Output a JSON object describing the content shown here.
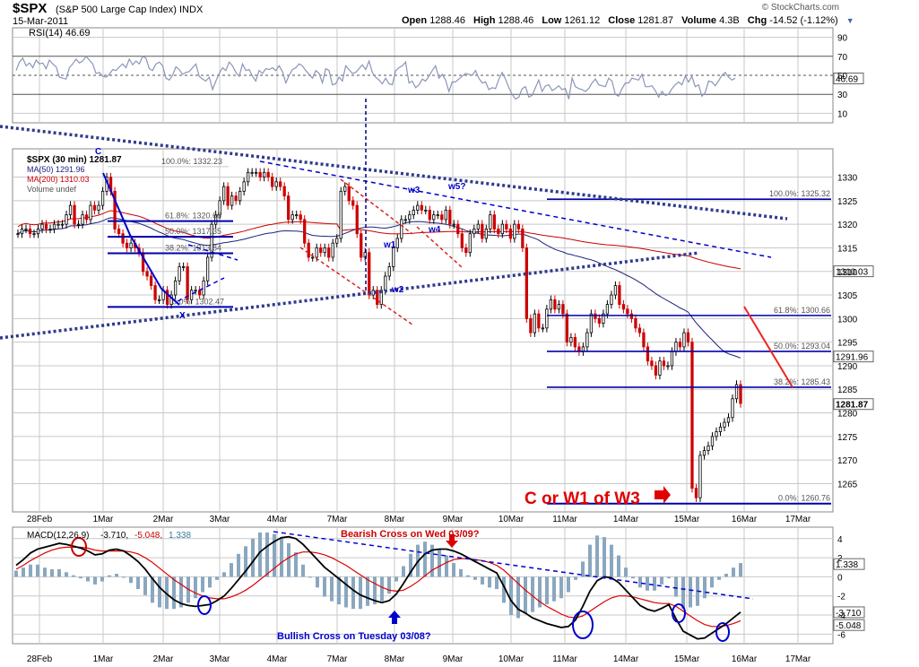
{
  "header": {
    "symbol": "$SPX",
    "name": "(S&P 500 Large Cap Index) INDX",
    "date": "15-Mar-2011",
    "open_label": "Open",
    "open": "1288.46",
    "high_label": "High",
    "high": "1288.46",
    "low_label": "Low",
    "low": "1261.12",
    "close_label": "Close",
    "close": "1281.87",
    "volume_label": "Volume",
    "volume": "4.3B",
    "chg_label": "Chg",
    "chg": "-14.52 (-1.12%)",
    "watermark": "© StockCharts.com"
  },
  "colors": {
    "grid": "#c8c8c8",
    "up": "#000000",
    "down": "#cc0000",
    "wave": "#0000cc",
    "ma50": "#1a237e",
    "ma200": "#cc0000",
    "fib": "#0000aa",
    "trend": "#2e3b8c",
    "annot": "#e00000"
  },
  "rsi": {
    "label": "RSI(14) 46.69",
    "value_label": "46.69",
    "ticks": [
      "90",
      "70",
      "50",
      "30",
      "10"
    ],
    "tick_values": [
      90,
      70,
      50,
      30,
      10
    ],
    "ylim": [
      0,
      100
    ],
    "values": [
      55,
      64,
      68,
      60,
      63,
      58,
      66,
      62,
      63,
      57,
      66,
      62,
      59,
      48,
      47,
      46,
      58,
      62,
      67,
      63,
      65,
      70,
      66,
      62,
      52,
      53,
      49,
      48,
      51,
      56,
      55,
      59,
      62,
      58,
      67,
      61,
      65,
      62,
      70,
      68,
      57,
      55,
      62,
      64,
      60,
      47,
      45,
      50,
      59,
      56,
      51,
      53,
      54,
      58,
      62,
      49,
      46,
      44,
      48,
      35,
      44,
      52,
      58,
      55,
      64,
      60,
      53,
      49,
      62,
      55,
      56,
      49,
      44,
      55,
      52,
      57,
      56,
      58,
      55,
      60,
      54,
      42,
      50,
      56,
      58,
      62,
      60,
      55,
      51,
      47,
      55,
      52,
      42,
      57,
      55,
      40,
      41,
      48,
      44,
      60,
      56,
      52,
      53,
      57,
      61,
      56,
      65,
      53,
      48,
      45,
      41,
      47,
      41,
      40,
      55,
      58,
      60,
      64,
      42,
      44,
      37,
      40,
      46,
      44,
      49,
      55,
      60,
      47,
      51,
      45,
      33,
      43,
      43,
      46,
      49,
      52,
      51,
      50,
      55,
      47,
      42,
      43,
      35,
      37,
      36,
      46,
      53,
      46,
      37,
      30,
      25,
      27,
      36,
      38,
      27,
      29,
      37,
      45,
      33,
      39,
      40,
      34,
      36,
      39,
      35,
      36,
      25,
      47,
      38,
      36,
      35,
      33,
      36,
      42,
      46,
      40,
      39,
      38,
      47,
      44,
      30,
      28,
      36,
      42,
      42,
      47,
      46,
      45,
      51,
      38,
      38,
      39,
      34,
      27,
      33,
      29,
      30,
      36,
      40,
      43,
      40,
      49,
      43,
      49,
      38,
      40,
      28,
      32,
      44,
      43,
      39,
      44,
      50,
      53,
      48,
      45,
      47
    ]
  },
  "price": {
    "legend_title": "$SPX (30 min) 1281.87",
    "legend_ma50": "MA(50) 1291.96",
    "legend_ma200": "MA(200) 1310.03",
    "legend_volume": "Volume undef",
    "ticks": [
      "1330",
      "1325",
      "1320",
      "1315",
      "1310",
      "1305",
      "1300",
      "1295",
      "1290",
      "1285",
      "1280",
      "1275",
      "1270",
      "1265"
    ],
    "tick_values": [
      1330,
      1325,
      1320,
      1315,
      1310,
      1305,
      1300,
      1295,
      1290,
      1285,
      1280,
      1275,
      1270,
      1265
    ],
    "ylim": [
      1259,
      1336
    ],
    "tag_ma200": "1310.03",
    "tag_ma50": "1291.96",
    "tag_last": "1281.87",
    "annotation": "C or W1 of W3",
    "wave_labels": [
      "C",
      "X",
      "w1",
      "w2",
      "w3",
      "w4",
      "w5?"
    ],
    "fib_left": [
      {
        "label": "100.0%: 1332.23",
        "value": 1332.23
      },
      {
        "label": "61.8%: 1320.66",
        "value": 1320.66
      },
      {
        "label": "50.0%: 1317.35",
        "value": 1317.35
      },
      {
        "label": "38.2%: 1313.84",
        "value": 1313.84
      },
      {
        "label": "0.0%: 1302.47",
        "value": 1302.47
      }
    ],
    "fib_right": [
      {
        "label": "100.0%: 1325.32",
        "value": 1325.32
      },
      {
        "label": "61.8%: 1300.66",
        "value": 1300.66
      },
      {
        "label": "50.0%: 1293.04",
        "value": 1293.04
      },
      {
        "label": "38.2%: 1285.43",
        "value": 1285.43
      },
      {
        "label": "0.0%: 1260.76",
        "value": 1260.76
      }
    ],
    "dates": [
      "28Feb",
      "1Mar",
      "2Mar",
      "3Mar",
      "4Mar",
      "7Mar",
      "8Mar",
      "9Mar",
      "10Mar",
      "11Mar",
      "14Mar",
      "15Mar",
      "16Mar",
      "17Mar"
    ],
    "closes": [
      1318,
      1319,
      1319,
      1318,
      1318,
      1319,
      1320,
      1319,
      1319,
      1320,
      1320,
      1320,
      1322,
      1324,
      1320,
      1320,
      1322,
      1321,
      1324,
      1323,
      1324,
      1327,
      1330,
      1327,
      1319,
      1318,
      1316,
      1315,
      1316,
      1315,
      1314,
      1310,
      1309,
      1307,
      1304,
      1304,
      1306,
      1303,
      1305,
      1308,
      1311,
      1311,
      1304,
      1306,
      1306,
      1305,
      1308,
      1313,
      1320,
      1322,
      1325,
      1328,
      1324,
      1326,
      1325,
      1327,
      1329,
      1331,
      1331,
      1331,
      1330,
      1331,
      1330,
      1328,
      1329,
      1328,
      1326,
      1321,
      1322,
      1322,
      1321,
      1316,
      1313,
      1313,
      1315,
      1314,
      1315,
      1313,
      1316,
      1317,
      1327,
      1328,
      1325,
      1324,
      1318,
      1313,
      1314,
      1305,
      1306,
      1303,
      1306,
      1309,
      1311,
      1315,
      1317,
      1321,
      1321,
      1322,
      1323,
      1324,
      1323,
      1323,
      1321,
      1322,
      1322,
      1321,
      1323,
      1320,
      1320,
      1318,
      1315,
      1314,
      1318,
      1319,
      1320,
      1317,
      1319,
      1322,
      1319,
      1318,
      1320,
      1319,
      1317,
      1320,
      1319,
      1315,
      1300,
      1297,
      1301,
      1298,
      1298,
      1302,
      1304,
      1302,
      1303,
      1301,
      1295,
      1296,
      1294,
      1293,
      1294,
      1297,
      1301,
      1300,
      1299,
      1301,
      1303,
      1305,
      1307,
      1303,
      1302,
      1301,
      1300,
      1298,
      1297,
      1294,
      1291,
      1290,
      1288,
      1291,
      1290,
      1290,
      1293,
      1295,
      1294,
      1297,
      1295,
      1264,
      1262,
      1271,
      1272,
      1273,
      1275,
      1276,
      1277,
      1278,
      1279,
      1283,
      1286,
      1282
    ]
  },
  "macd": {
    "label_name": "MACD(12,26,9)",
    "label_macd": "-3.710,",
    "label_signal": "-5.048,",
    "label_hist": "1.338",
    "tag_hist": "1.338",
    "tag_macd": "-3.710",
    "tag_signal": "-5.048",
    "ticks": [
      "4",
      "2",
      "0",
      "-2",
      "-4",
      "-6"
    ],
    "tick_values": [
      4,
      2,
      0,
      -2,
      -4,
      -6
    ],
    "ylim": [
      -7,
      5.2
    ],
    "bearish_text": "Bearish Cross on Wed 03/09?",
    "bullish_text": "Bullish Cross on Tuesday 03/08?",
    "macd_values": [
      1.2,
      1.8,
      2.5,
      2.9,
      3.1,
      3.3,
      3.5,
      3.4,
      3.2,
      3.0,
      2.7,
      2.3,
      2.4,
      2.8,
      2.9,
      2.7,
      2.2,
      1.6,
      0.8,
      -0.2,
      -1.1,
      -1.8,
      -2.4,
      -2.8,
      -3.0,
      -3.1,
      -3.0,
      -2.9,
      -2.5,
      -2.0,
      -1.2,
      -0.3,
      0.6,
      1.6,
      2.6,
      3.2,
      3.7,
      4.1,
      4.2,
      4.0,
      3.4,
      2.6,
      1.8,
      1.0,
      0.4,
      -0.2,
      -0.8,
      -1.4,
      -1.9,
      -2.2,
      -2.5,
      -2.7,
      -2.5,
      -1.8,
      -0.7,
      0.5,
      1.6,
      2.4,
      2.8,
      2.9,
      2.9,
      2.7,
      2.4,
      2.0,
      1.6,
      1.2,
      0.8,
      0.4,
      -1.0,
      -2.5,
      -3.4,
      -3.8,
      -4.3,
      -4.6,
      -4.9,
      -5.1,
      -5.3,
      -5.2,
      -4.5,
      -3.1,
      -1.5,
      -0.4,
      0.0,
      -0.1,
      -0.6,
      -1.4,
      -2.2,
      -3.0,
      -3.4,
      -3.6,
      -3.3,
      -2.9,
      -4.4,
      -5.7,
      -6.1,
      -6.5,
      -6.4,
      -5.9,
      -5.4,
      -4.9,
      -4.3,
      -3.7
    ],
    "signal_values": [
      0.8,
      1.2,
      1.7,
      2.1,
      2.5,
      2.8,
      3.0,
      3.1,
      3.1,
      3.1,
      3.0,
      2.8,
      2.7,
      2.7,
      2.7,
      2.7,
      2.6,
      2.4,
      2.0,
      1.5,
      0.9,
      0.3,
      -0.3,
      -0.8,
      -1.3,
      -1.7,
      -2.0,
      -2.2,
      -2.3,
      -2.3,
      -2.1,
      -1.8,
      -1.4,
      -0.9,
      -0.3,
      0.3,
      0.9,
      1.5,
      2.0,
      2.4,
      2.6,
      2.6,
      2.5,
      2.3,
      2.0,
      1.6,
      1.2,
      0.7,
      0.2,
      -0.3,
      -0.7,
      -1.1,
      -1.4,
      -1.5,
      -1.4,
      -1.0,
      -0.5,
      0.1,
      0.7,
      1.1,
      1.5,
      1.8,
      1.9,
      1.9,
      1.8,
      1.7,
      1.5,
      1.2,
      0.7,
      0.0,
      -0.7,
      -1.4,
      -2.0,
      -2.6,
      -3.1,
      -3.5,
      -3.9,
      -4.2,
      -4.3,
      -4.1,
      -3.6,
      -3.1,
      -2.6,
      -2.2,
      -2.0,
      -2.0,
      -2.1,
      -2.3,
      -2.5,
      -2.7,
      -2.8,
      -2.8,
      -3.1,
      -3.6,
      -4.1,
      -4.6,
      -5.0,
      -5.2,
      -5.2,
      -5.1,
      -4.9,
      -4.6
    ]
  }
}
